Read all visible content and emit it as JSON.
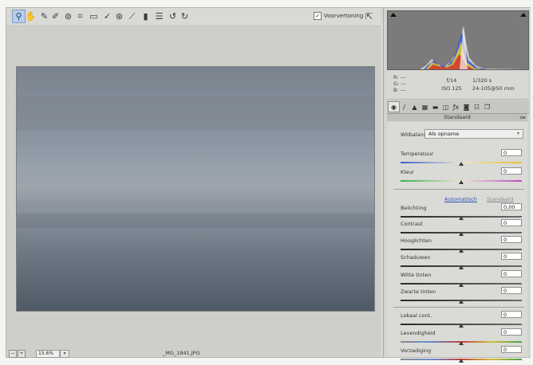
{
  "toolbar": {
    "tools": [
      {
        "icon": "zoom-tool-icon",
        "glyph": "⚲",
        "active": true
      },
      {
        "icon": "hand-tool-icon",
        "glyph": "✋"
      },
      {
        "icon": "white-balance-tool-icon",
        "glyph": "✎"
      },
      {
        "icon": "color-sampler-tool-icon",
        "glyph": "✐"
      },
      {
        "icon": "targeted-adjustment-tool-icon",
        "glyph": "⊚"
      },
      {
        "icon": "crop-tool-icon",
        "glyph": "⌗"
      },
      {
        "icon": "straighten-tool-icon",
        "glyph": "▭"
      },
      {
        "icon": "spot-removal-tool-icon",
        "glyph": "✓"
      },
      {
        "icon": "red-eye-tool-icon",
        "glyph": "⊛"
      },
      {
        "icon": "adjustment-brush-icon",
        "glyph": "⟋"
      },
      {
        "icon": "graduated-filter-icon",
        "glyph": "▮"
      },
      {
        "icon": "preferences-icon",
        "glyph": "☰"
      },
      {
        "icon": "rotate-left-icon",
        "glyph": "↺"
      },
      {
        "icon": "rotate-right-icon",
        "glyph": "↻"
      }
    ],
    "preview_label": "Voorvertoning",
    "preview_checked": "✓",
    "fullscreen_glyph": "⇱"
  },
  "status": {
    "zoom_value": "15.6%",
    "zoom_arrow": "▾",
    "filename": "_MG_1841.JPG",
    "minus_glyph": "−",
    "plus_glyph": "+"
  },
  "info": {
    "r_label": "R:",
    "r_value": "---",
    "g_label": "G:",
    "g_value": "---",
    "b_label": "B:",
    "b_value": "---",
    "aperture": "f/14",
    "shutter": "1/320 s",
    "iso": "ISO 125",
    "lens": "24-105@50 mm"
  },
  "panel": {
    "tabs": [
      {
        "icon": "basic-tab-icon",
        "glyph": "◉",
        "active": true
      },
      {
        "icon": "tone-curve-tab-icon",
        "glyph": "∕"
      },
      {
        "icon": "detail-tab-icon",
        "glyph": "▲"
      },
      {
        "icon": "hsl-tab-icon",
        "glyph": "▦"
      },
      {
        "icon": "split-toning-tab-icon",
        "glyph": "▬"
      },
      {
        "icon": "lens-corrections-tab-icon",
        "glyph": "◫"
      },
      {
        "icon": "effects-tab-icon",
        "glyph": "ƒx"
      },
      {
        "icon": "camera-calibration-tab-icon",
        "glyph": "◙"
      },
      {
        "icon": "presets-tab-icon",
        "glyph": "☷"
      },
      {
        "icon": "snapshots-tab-icon",
        "glyph": "❐"
      }
    ],
    "section_title": "Standaard",
    "section_menu": "≡▸"
  },
  "controls": {
    "wb_label": "Witbalans:",
    "wb_value": "Als opname",
    "wb_arrow": "▾",
    "auto_label": "Automatisch",
    "default_label": "Standaard",
    "sliders": [
      {
        "label": "Temperatuur",
        "value": "0",
        "pos": 0.5,
        "track": "temperature"
      },
      {
        "label": "Kleur",
        "value": "0",
        "pos": 0.5,
        "track": "tint"
      },
      {
        "label": "Belichting",
        "value": "0,00",
        "pos": 0.5,
        "track": "gray"
      },
      {
        "label": "Contrast",
        "value": "0",
        "pos": 0.5,
        "track": "gray"
      },
      {
        "label": "Hooglichten",
        "value": "0",
        "pos": 0.5,
        "track": "gray"
      },
      {
        "label": "Schaduwen",
        "value": "0",
        "pos": 0.5,
        "track": "gray"
      },
      {
        "label": "Witte tinten",
        "value": "0",
        "pos": 0.5,
        "track": "gray"
      },
      {
        "label": "Zwarte tinten",
        "value": "0",
        "pos": 0.5,
        "track": "gray"
      },
      {
        "label": "Lokaal cont.",
        "value": "0",
        "pos": 0.5,
        "track": "gray"
      },
      {
        "label": "Levendigheid",
        "value": "0",
        "pos": 0.5,
        "track": "saturation"
      },
      {
        "label": "Verzadiging",
        "value": "0",
        "pos": 0.5,
        "track": "saturation"
      }
    ]
  },
  "colors": {
    "accent": "#2c54b5",
    "active_tool": "#b9cde6"
  }
}
